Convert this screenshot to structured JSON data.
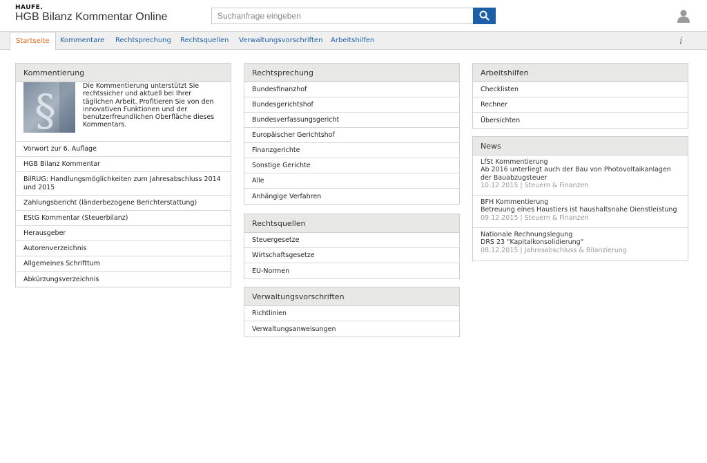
{
  "header": {
    "brand": "HAUFE.",
    "title": "HGB Bilanz Kommentar Online",
    "search_placeholder": "Suchanfrage eingeben"
  },
  "nav": {
    "tabs": [
      "Startseite",
      "Kommentare",
      "Rechtsprechung",
      "Rechtsquellen",
      "Verwaltungsvorschriften",
      "Arbeitshilfen"
    ],
    "active": "Startseite",
    "info": "i"
  },
  "kommentierung": {
    "title": "Kommentierung",
    "intro": "Die Kommentierung unterstützt Sie rechtssicher und aktuell bei Ihrer täglichen Arbeit. Profitieren Sie von den innovativen Funktionen und der benutzerfreundlichen Oberfläche dieses Kommentars.",
    "items": [
      "Vorwort zur 6. Auflage",
      "HGB Bilanz Kommentar",
      "BilRUG: Handlungsmöglichkeiten zum Jahresabschluss 2014 und 2015",
      "Zahlungsbericht (länderbezogene Berichterstattung)",
      "EStG Kommentar (Steuerbilanz)",
      "Herausgeber",
      "Autorenverzeichnis",
      "Allgemeines Schrifttum",
      "Abkürzungsverzeichnis"
    ]
  },
  "rechtsprechung": {
    "title": "Rechtsprechung",
    "items": [
      "Bundesfinanzhof",
      "Bundesgerichtshof",
      "Bundesverfassungsgericht",
      "Europäischer Gerichtshof",
      "Finanzgerichte",
      "Sonstige Gerichte",
      "Alle",
      "Anhängige Verfahren"
    ]
  },
  "rechtsquellen": {
    "title": "Rechtsquellen",
    "items": [
      "Steuergesetze",
      "Wirtschaftsgesetze",
      "EU-Normen"
    ]
  },
  "verwaltungsvorschriften": {
    "title": "Verwaltungsvorschriften",
    "items": [
      "Richtlinien",
      "Verwaltungsanweisungen"
    ]
  },
  "arbeitshilfen": {
    "title": "Arbeitshilfen",
    "items": [
      "Checklisten",
      "Rechner",
      "Übersichten"
    ]
  },
  "news": {
    "title": "News",
    "items": [
      {
        "source": "LfSt Kommentierung",
        "headline": "Ab 2016 unterliegt auch der Bau von Photovoltaikanlagen der Bauabzugsteuer",
        "meta": "10.12.2015 | Steuern & Finanzen"
      },
      {
        "source": "BFH Kommentierung",
        "headline": "Betreuung eines Haustiers ist haushaltsnahe Dienstleistung",
        "meta": "09.12.2015 | Steuern & Finanzen"
      },
      {
        "source": "Nationale Rechnungslegung",
        "headline": "DRS 23 \"Kapitalkonsolidierung\"",
        "meta": "08.12.2015 | Jahresabschluss & Bilanzierung"
      }
    ]
  },
  "colors": {
    "accent": "#1c5fa8",
    "active_tab": "#e06a1b",
    "panel_header": "#e8e8e6"
  },
  "icons": {
    "search": "search-icon",
    "user": "user-icon",
    "info": "info-icon"
  }
}
